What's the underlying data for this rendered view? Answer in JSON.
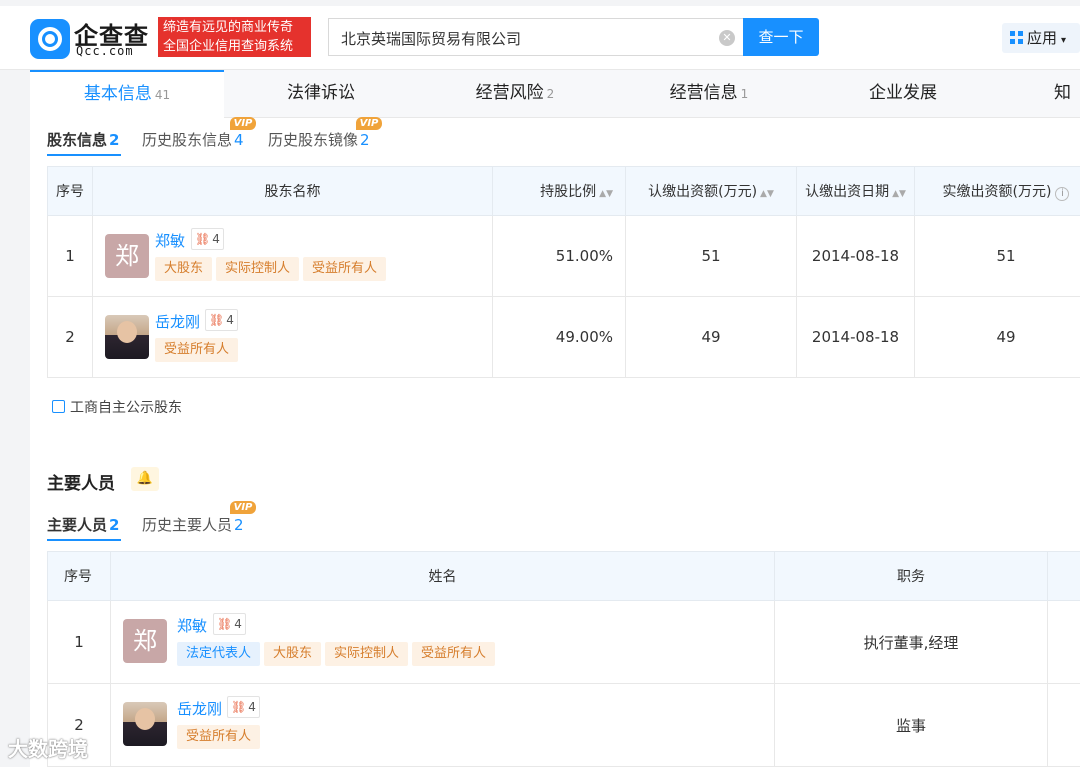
{
  "header": {
    "logo_text": "企查查",
    "logo_sub": "Qcc.com",
    "slogan_line1": "缔造有远见的商业传奇",
    "slogan_line2": "全国企业信用查询系统",
    "search_value": "北京英瑞国际贸易有限公司",
    "search_button": "查一下",
    "apps_label": "应用",
    "icons": {
      "logo": "qcc-logo-icon",
      "clear": "clear-icon",
      "apps": "grid-icon",
      "caret": "chevron-down-icon"
    },
    "accent_color": "#1890ff",
    "slogan_color": "#e5322d"
  },
  "tabs": [
    {
      "label": "基本信息",
      "count": "41"
    },
    {
      "label": "法律诉讼",
      "count": ""
    },
    {
      "label": "经营风险",
      "count": "2"
    },
    {
      "label": "经营信息",
      "count": "1"
    },
    {
      "label": "企业发展",
      "count": ""
    },
    {
      "label": "知识",
      "count": ""
    }
  ],
  "shareholders": {
    "subtabs": [
      {
        "label": "股东信息",
        "count": "2"
      },
      {
        "label": "历史股东信息",
        "count": "4",
        "vip": "VIP"
      },
      {
        "label": "历史股东镜像",
        "count": "2",
        "vip": "VIP"
      }
    ],
    "columns": [
      "序号",
      "股东名称",
      "持股比例",
      "认缴出资额(万元)",
      "认缴出资日期",
      "实缴出资额(万元)"
    ],
    "rows": [
      {
        "index": "1",
        "avatar_char": "郑",
        "name": "郑敏",
        "relations": "4",
        "tags": [
          "大股东",
          "实际控制人",
          "受益所有人"
        ],
        "ratio": "51.00%",
        "subscribed": "51",
        "date": "2014-08-18",
        "paid": "51"
      },
      {
        "index": "2",
        "avatar_char": "",
        "name": "岳龙刚",
        "relations": "4",
        "tags": [
          "受益所有人"
        ],
        "ratio": "49.00%",
        "subscribed": "49",
        "date": "2014-08-18",
        "paid": "49"
      }
    ],
    "footer_link": "工商自主公示股东"
  },
  "personnel": {
    "title": "主要人员",
    "subtabs": [
      {
        "label": "主要人员",
        "count": "2"
      },
      {
        "label": "历史主要人员",
        "count": "2",
        "vip": "VIP"
      }
    ],
    "columns": [
      "序号",
      "姓名",
      "职务"
    ],
    "rows": [
      {
        "index": "1",
        "avatar_char": "郑",
        "name": "郑敏",
        "relations": "4",
        "tags": [
          "法定代表人",
          "大股东",
          "实际控制人",
          "受益所有人"
        ],
        "position": "执行董事,经理"
      },
      {
        "index": "2",
        "avatar_char": "",
        "name": "岳龙刚",
        "relations": "4",
        "tags": [
          "受益所有人"
        ],
        "position": "监事"
      }
    ]
  },
  "watermark": "大数跨境"
}
